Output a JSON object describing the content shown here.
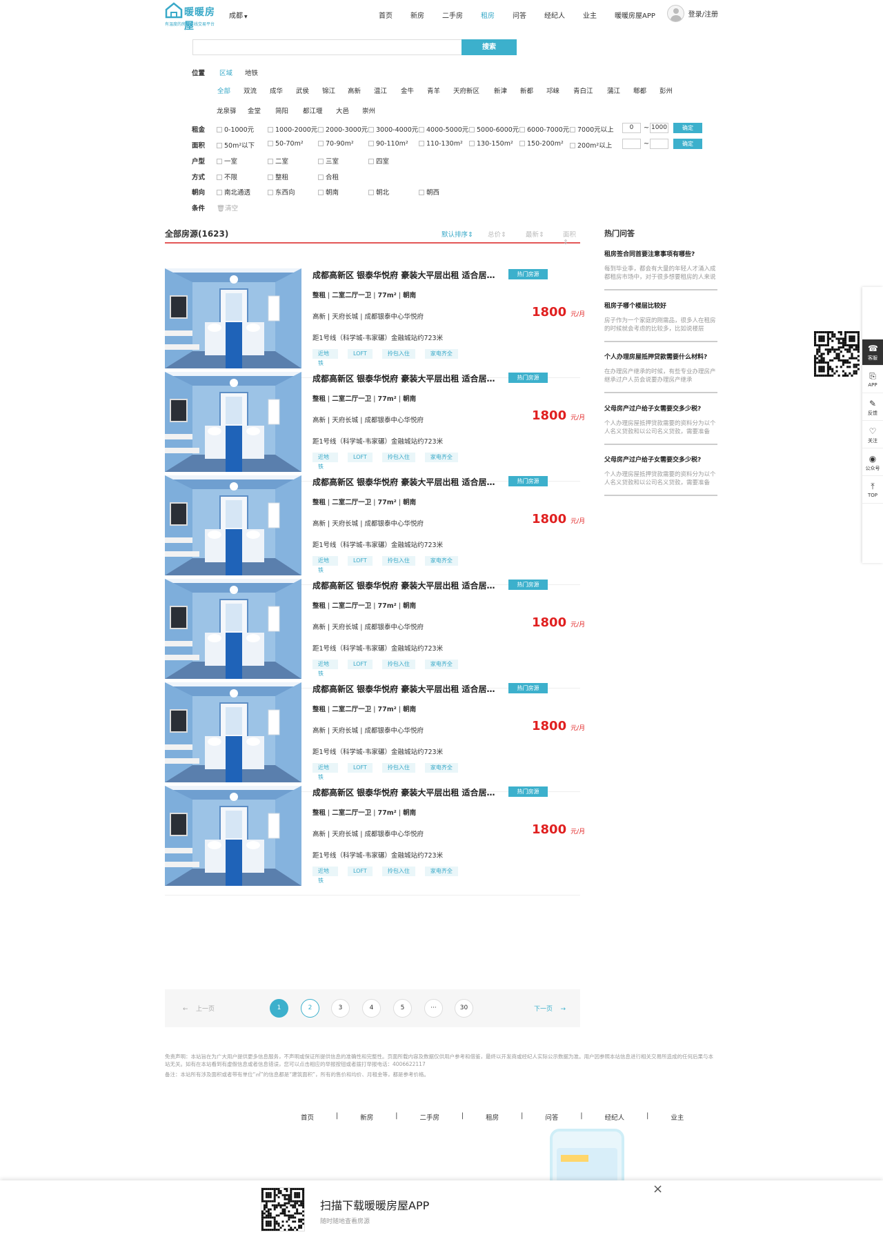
{
  "header": {
    "logo_name": "暖暖房屋",
    "logo_slogan": "有温度的房屋在线交易平台",
    "city": "成都",
    "nav": [
      "首页",
      "新房",
      "二手房",
      "租房",
      "问答",
      "经纪人",
      "业主",
      "暖暖房屋APP"
    ],
    "active_nav": "租房",
    "login": "登录/注册"
  },
  "search": {
    "button": "搜索",
    "placeholder": ""
  },
  "filters": {
    "position_label": "位置",
    "position_tabs": [
      "区域",
      "地铁"
    ],
    "districts_row1": [
      "全部",
      "双流",
      "成华",
      "武侯",
      "锦江",
      "高新",
      "温江",
      "金牛",
      "青羊",
      "天府新区",
      "新津",
      "新都",
      "邛崃",
      "青白江",
      "蒲江",
      "郫都",
      "彭州"
    ],
    "districts_row2": [
      "龙泉驿",
      "金堂",
      "简阳",
      "都江堰",
      "大邑",
      "崇州"
    ],
    "rent_label": "租金",
    "rent_opts": [
      "0-1000元",
      "1000-2000元",
      "2000-3000元",
      "3000-4000元",
      "4000-5000元",
      "5000-6000元",
      "6000-7000元",
      "7000元以上"
    ],
    "rent_min": "0",
    "rent_max": "1000",
    "area_label": "面积",
    "area_opts": [
      "50m²以下",
      "50-70m²",
      "70-90m²",
      "90-110m²",
      "110-130m²",
      "130-150m²",
      "150-200m²",
      "200m²以上"
    ],
    "area_min": "",
    "area_max": "",
    "tilde": "~",
    "confirm": "确定",
    "type_label": "户型",
    "type_opts": [
      "一室",
      "二室",
      "三室",
      "四室"
    ],
    "mode_label": "方式",
    "mode_opts": [
      "不限",
      "整租",
      "合租"
    ],
    "orient_label": "朝向",
    "orient_opts": [
      "南北通透",
      "东西向",
      "朝南",
      "朝北",
      "朝西"
    ],
    "cond_label": "条件",
    "clear": "清空"
  },
  "list_header": {
    "title": "全部房源(1623)",
    "sorts": [
      "默认排序",
      "总价",
      "最新",
      "面积"
    ],
    "active_sort": "默认排序"
  },
  "listings": [
    {
      "title": "成都高新区 银泰华悦府 豪装大平层出租 适合居家办公",
      "badge": "热门房源",
      "mode": "整租",
      "layout": "二室二厅一卫",
      "area": "77m²",
      "orient": "朝南",
      "district": "高新",
      "block": "天府长城",
      "estate": "成都银泰中心华悦府",
      "subway": "距1号线（科学城-韦家碾）金融城站约723米",
      "tags": [
        "近地铁",
        "LOFT",
        "拎包入住",
        "家电齐全"
      ],
      "price": "1800",
      "unit": "元/月"
    },
    {
      "title": "成都高新区 银泰华悦府 豪装大平层出租 适合居家办公",
      "badge": "热门房源",
      "mode": "整租",
      "layout": "二室二厅一卫",
      "area": "77m²",
      "orient": "朝南",
      "district": "高新",
      "block": "天府长城",
      "estate": "成都银泰中心华悦府",
      "subway": "距1号线（科学城-韦家碾）金融城站约723米",
      "tags": [
        "近地铁",
        "LOFT",
        "拎包入住",
        "家电齐全"
      ],
      "price": "1800",
      "unit": "元/月"
    },
    {
      "title": "成都高新区 银泰华悦府 豪装大平层出租 适合居家办公",
      "badge": "热门房源",
      "mode": "整租",
      "layout": "二室二厅一卫",
      "area": "77m²",
      "orient": "朝南",
      "district": "高新",
      "block": "天府长城",
      "estate": "成都银泰中心华悦府",
      "subway": "距1号线（科学城-韦家碾）金融城站约723米",
      "tags": [
        "近地铁",
        "LOFT",
        "拎包入住",
        "家电齐全"
      ],
      "price": "1800",
      "unit": "元/月"
    },
    {
      "title": "成都高新区 银泰华悦府 豪装大平层出租 适合居家办公",
      "badge": "热门房源",
      "mode": "整租",
      "layout": "二室二厅一卫",
      "area": "77m²",
      "orient": "朝南",
      "district": "高新",
      "block": "天府长城",
      "estate": "成都银泰中心华悦府",
      "subway": "距1号线（科学城-韦家碾）金融城站约723米",
      "tags": [
        "近地铁",
        "LOFT",
        "拎包入住",
        "家电齐全"
      ],
      "price": "1800",
      "unit": "元/月"
    },
    {
      "title": "成都高新区 银泰华悦府 豪装大平层出租 适合居家办公",
      "badge": "热门房源",
      "mode": "整租",
      "layout": "二室二厅一卫",
      "area": "77m²",
      "orient": "朝南",
      "district": "高新",
      "block": "天府长城",
      "estate": "成都银泰中心华悦府",
      "subway": "距1号线（科学城-韦家碾）金融城站约723米",
      "tags": [
        "近地铁",
        "LOFT",
        "拎包入住",
        "家电齐全"
      ],
      "price": "1800",
      "unit": "元/月"
    },
    {
      "title": "成都高新区 银泰华悦府 豪装大平层出租 适合居家办公",
      "badge": "热门房源",
      "mode": "整租",
      "layout": "二室二厅一卫",
      "area": "77m²",
      "orient": "朝南",
      "district": "高新",
      "block": "天府长城",
      "estate": "成都银泰中心华悦府",
      "subway": "距1号线（科学城-韦家碾）金融城站约723米",
      "tags": [
        "近地铁",
        "LOFT",
        "拎包入住",
        "家电齐全"
      ],
      "price": "1800",
      "unit": "元/月"
    }
  ],
  "hot_qa": {
    "title": "热门问答",
    "items": [
      {
        "q": "租房签合同首要注意事项有哪些?",
        "a": "每到毕业季，都会有大量的年轻人才涌入成都租房市场中，对于很多想要租房的人来说"
      },
      {
        "q": "租房子哪个楼层比较好",
        "a": "房子作为一个家庭的刚需品，很多人在租房的时候就会考虑的比较多，比如说楼层"
      },
      {
        "q": "个人办理房屋抵押贷款需要什么材料?",
        "a": "在办理房产继承的时候，有些专业办理房产继承过户人员会说要办理房产继承"
      },
      {
        "q": "父母房产过户给子女需要交多少税?",
        "a": "个人办理房屋抵押贷款需要的资料分为以个人名义贷款和以公司名义贷款，需要准备"
      },
      {
        "q": "父母房产过户给子女需要交多少税?",
        "a": "个人办理房屋抵押贷款需要的资料分为以个人名义贷款和以公司名义贷款，需要准备"
      }
    ]
  },
  "pager": {
    "prev": "上一页",
    "next": "下一页",
    "pages": [
      "1",
      "2",
      "3",
      "4",
      "5",
      "···",
      "30"
    ],
    "current": "1"
  },
  "disclaimer": {
    "line1": "免责声明：本站旨在为广大用户提供更多信息服务，不声明或保证所提供信息的准确性和完整性。页面所载内容及数据仅供用户参考和借鉴，最终以开发商或经纪人实际公示数据为准。用户因参照本站信息进行相关交易所造成的任何后果与本站无关。如有在本站看到有虚假信息或者信息错误，您可以点击相应的举报按钮或者拨打举报电话：4006622117",
    "line2": "备注：本站所有涉及面积或者带有单位“㎡”的信息都是“建筑面积”，所有的售价和均价、月租金等，都是参考价格。"
  },
  "footer_nav": [
    "首页",
    "|",
    "新房",
    "|",
    "二手房",
    "|",
    "租房",
    "|",
    "问答",
    "|",
    "经纪人",
    "|",
    "业主"
  ],
  "sidebar": {
    "items": [
      "客服",
      "APP",
      "反馈",
      "关注",
      "公众号",
      "TOP"
    ]
  },
  "bottom_bar": {
    "title": "扫描下载暖暖房屋APP",
    "sub": "随时随地查看房源",
    "close": "×"
  },
  "colors": {
    "accent": "#3cb0cc",
    "price": "#e02020",
    "sort_line": "#e35656"
  }
}
